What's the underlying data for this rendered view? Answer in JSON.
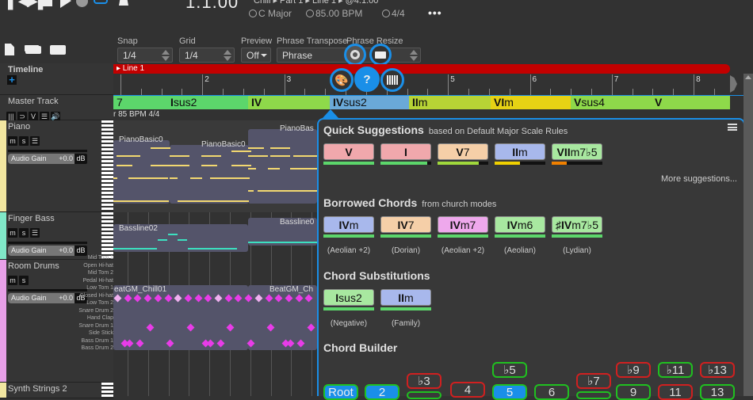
{
  "transport": {
    "icons": [
      "skip-back-icon",
      "skip-forward-icon",
      "stop-icon",
      "play-icon",
      "record-icon",
      "loop-icon",
      "metronome-icon"
    ],
    "position": "1.1.00",
    "breadcrumb": "Chill ▸ Part 1 ▸ Line 1 ▸ @4.1.00",
    "key": "C Major",
    "tempo": "85.00 BPM",
    "time_signature": "4/4",
    "more_label": "•••"
  },
  "toolbar": {
    "snap": {
      "label": "Snap",
      "value": "1/4"
    },
    "grid": {
      "label": "Grid",
      "value": "1/4"
    },
    "preview": {
      "label": "Preview",
      "value": "Off"
    },
    "phrase_transpose": {
      "label": "Phrase Transpose",
      "value": "Phrase"
    },
    "phrase_resize": {
      "label": "Phrase Resize"
    }
  },
  "timeline": {
    "label": "Timeline",
    "add_label": "+",
    "line_name": "▸ Line 1",
    "measures": [
      "2",
      "3",
      "4",
      "5",
      "6",
      "7",
      "8"
    ]
  },
  "master": {
    "label": "Master Track",
    "buttons": [
      "|||",
      "⊃",
      "V",
      "☰",
      "🔊"
    ],
    "info": "r  85 BPM  4/4",
    "chords": [
      {
        "root": "",
        "ext": "7",
        "color": "#5cd66b"
      },
      {
        "root": "I",
        "ext": "sus2",
        "color": "#5cd66b"
      },
      {
        "root": "IV",
        "ext": "",
        "color": "#8ed94a"
      },
      {
        "root": "IV",
        "ext": "sus2",
        "color": "#6aa9d8"
      },
      {
        "root": "II",
        "ext": "m",
        "color": "#b7d435"
      },
      {
        "root": "VI",
        "ext": "m",
        "color": "#e6d214"
      },
      {
        "root": "V",
        "ext": "sus4",
        "color": "#8ed94a"
      },
      {
        "root": "V",
        "ext": "",
        "color": "#8ed94a"
      }
    ]
  },
  "tracks": [
    {
      "name": "Piano",
      "buttons": [
        "m",
        "s",
        "☰"
      ],
      "gain_label": "Audio Gain",
      "gain_value": "+0.0",
      "gain_unit": "dB",
      "color": "#f2e6a0",
      "clips": [
        "PianoBasic0",
        "PianoBasic0",
        "PianoBas"
      ]
    },
    {
      "name": "Finger Bass",
      "buttons": [
        "m",
        "s",
        "☰"
      ],
      "gain_label": "Audio Gain",
      "gain_value": "+0.0",
      "gain_unit": "dB",
      "color": "#80e8c8",
      "clips": [
        "Bassline02",
        "Bassline0"
      ]
    },
    {
      "name": "Room Drums",
      "buttons": [
        "m",
        "s"
      ],
      "gain_label": "Audio Gain",
      "gain_value": "+0.0",
      "gain_unit": "dB",
      "color": "#e8a0e8",
      "clips": [
        "eatGM_Chill01",
        "BeatGM_Ch"
      ],
      "drum_names": [
        "Mid Tom 1",
        "Open Hi-hat",
        "Mid Tom 2",
        "Pedal Hi-hat",
        "Low Tom 1",
        "Closed Hi-hat",
        "Low Tom 2",
        "Snare Drum 2",
        "Hand Clap",
        "Snare Drum 1",
        "Side Stick",
        "Bass Drum 1",
        "Bass Drum 2"
      ]
    },
    {
      "name": "Synth Strings 2",
      "color": "#f2e6a0"
    }
  ],
  "popup": {
    "quick": {
      "title": "Quick Suggestions",
      "subtitle": "based on  Default Major Scale Rules",
      "chips": [
        {
          "root": "V",
          "ext": "",
          "bg": "#f0a8ac",
          "score": 1.0,
          "bar": "#5cd66b"
        },
        {
          "root": "I",
          "ext": "",
          "bg": "#f0a8ac",
          "score": 0.92,
          "bar": "#5cd66b"
        },
        {
          "root": "V",
          "ext": "7",
          "bg": "#f5cfa8",
          "score": 0.82,
          "bar": "#a0d83c"
        },
        {
          "root": "II",
          "ext": "m",
          "bg": "#a8b8ec",
          "score": 0.5,
          "bar": "#f0d000"
        },
        {
          "root": "VII",
          "ext": "m7♭5",
          "bg": "#a8e8a0",
          "score": 0.3,
          "bar": "#f08000"
        }
      ],
      "more": "More suggestions..."
    },
    "borrowed": {
      "title": "Borrowed Chords",
      "subtitle": "from  church modes",
      "chips": [
        {
          "root": "IV",
          "ext": "m",
          "bg": "#a8b8ec",
          "note": "(Aeolian +2)"
        },
        {
          "root": "IV",
          "ext": "7",
          "bg": "#f5cfa8",
          "note": "(Dorian)"
        },
        {
          "root": "IV",
          "ext": "m7",
          "bg": "#eea8ec",
          "note": "(Aeolian +2)"
        },
        {
          "root": "IV",
          "ext": "m6",
          "bg": "#a8e8a0",
          "note": "(Aeolian)"
        },
        {
          "root": "♯IV",
          "ext": "m7♭5",
          "bg": "#a8e8a0",
          "note": "(Lydian)"
        }
      ]
    },
    "substitutions": {
      "title": "Chord Substitutions",
      "chips": [
        {
          "root": "I",
          "ext": "sus2",
          "bg": "#a8e8a0",
          "note": "(Negative)"
        },
        {
          "root": "II",
          "ext": "m",
          "bg": "#a8b8ec",
          "note": "(Family)"
        }
      ]
    },
    "builder": {
      "title": "Chord Builder",
      "top_row": [
        {
          "label": "♭5",
          "state": "green"
        },
        {
          "label": "♭9",
          "state": "red"
        },
        {
          "label": "♭11",
          "state": "green"
        },
        {
          "label": "♭13",
          "state": "red"
        }
      ],
      "mid_row": [
        {
          "label": "♭3",
          "state": "red"
        },
        {
          "label": "♭7",
          "state": "red"
        }
      ],
      "bottom_row": [
        {
          "label": "Root",
          "state": "blue"
        },
        {
          "label": "2",
          "state": "blue"
        },
        {
          "label": "4",
          "state": "red"
        },
        {
          "label": "5",
          "state": "blue"
        },
        {
          "label": "6",
          "state": "green"
        },
        {
          "label": "9",
          "state": "green"
        },
        {
          "label": "11",
          "state": "red"
        },
        {
          "label": "13",
          "state": "green"
        }
      ]
    }
  }
}
